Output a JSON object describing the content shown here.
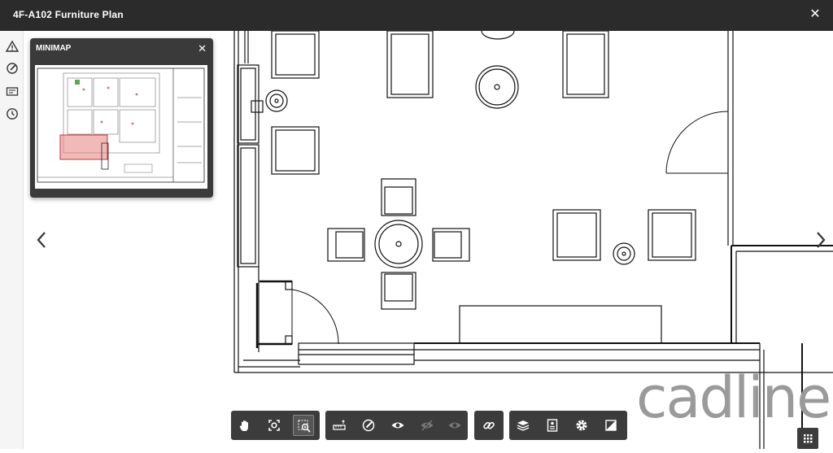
{
  "window": {
    "title": "4F-A102 Furniture Plan",
    "close_glyph": "✕"
  },
  "minimap": {
    "title": "MINIMAP",
    "close_glyph": "✕"
  },
  "left_rail": {
    "items": [
      {
        "icon": "warning-icon"
      },
      {
        "icon": "markup-icon"
      },
      {
        "icon": "properties-icon"
      },
      {
        "icon": "history-icon"
      }
    ]
  },
  "toolbar": {
    "groups": [
      {
        "tools": [
          "pan-tool-icon",
          "fit-view-icon",
          "zoom-window-icon"
        ]
      },
      {
        "tools": [
          "measure-icon",
          "markup-pen-icon",
          "show-markups-icon",
          "hide-markups-icon",
          "markup-visibility-icon"
        ]
      },
      {
        "tools": [
          "link-icon"
        ]
      },
      {
        "tools": [
          "layers-icon",
          "sheet-properties-icon",
          "settings-icon",
          "compare-icon"
        ]
      }
    ]
  },
  "watermark": {
    "text": "cadline"
  },
  "colors": {
    "titlebar": "#2b2b2b",
    "toolbar": "#3c3c3c",
    "minimap_viewport": "#e88080"
  }
}
